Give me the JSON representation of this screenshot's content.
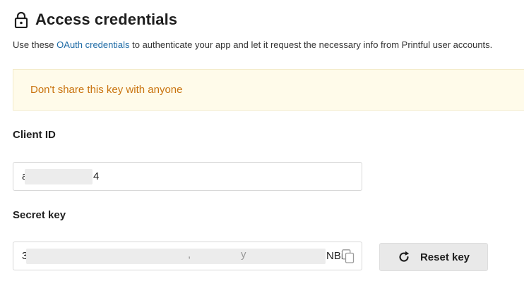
{
  "header": {
    "title": "Access credentials",
    "icon": "lock-icon"
  },
  "description": {
    "prefix": "Use these ",
    "link": "OAuth credentials",
    "suffix": " to authenticate your app and let it request the necessary info from Printful user accounts."
  },
  "warning": {
    "text": "Don't share this key with anyone",
    "color": "#c9730e",
    "background": "#fffbea"
  },
  "client_id": {
    "label": "Client ID",
    "value_start": "a",
    "value_end": "4"
  },
  "secret_key": {
    "label": "Secret key",
    "value_start": "3",
    "value_middle": ",",
    "value_middle2": "y",
    "value_end": "NBiE",
    "copy_icon": "copy-icon"
  },
  "reset_button": {
    "label": "Reset key",
    "icon": "refresh-icon"
  }
}
